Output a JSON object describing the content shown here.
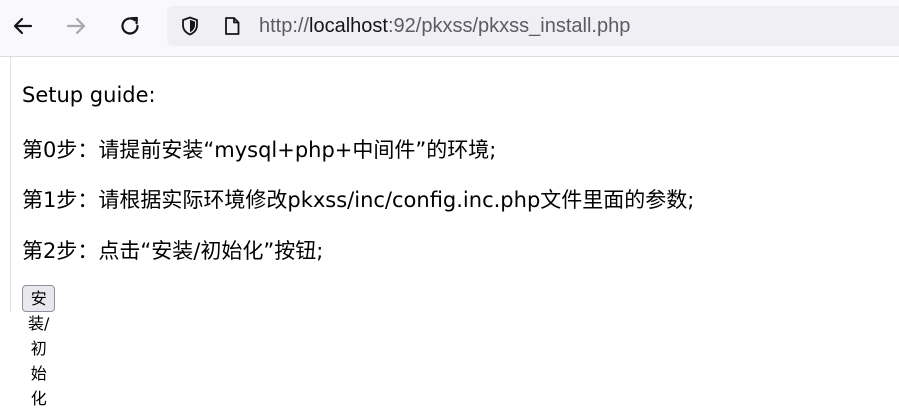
{
  "browser": {
    "url_prefix": "http://",
    "url_host": "localhost",
    "url_rest": ":92/pkxss/pkxss_install.php",
    "icons": {
      "back": "arrow-left",
      "forward": "arrow-right",
      "reload": "reload",
      "tracking_protection": "shield",
      "page_info": "page"
    }
  },
  "page": {
    "heading": "Setup guide:",
    "steps": [
      "第0步：请提前安装“mysql+php+中间件”的环境;",
      "第1步：请根据实际环境修改pkxss/inc/config.inc.php文件里面的参数;",
      "第2步：点击“安装/初始化”按钮;"
    ],
    "install_button_label": "安装/初始化"
  },
  "colors": {
    "toolbar_bg": "#f9f9fb",
    "urlbar_bg": "#f0f0f4",
    "url_text": "#5b5b66",
    "url_host": "#15141a",
    "button_bg": "#e9e9ed",
    "button_border": "#8f8f9d"
  }
}
